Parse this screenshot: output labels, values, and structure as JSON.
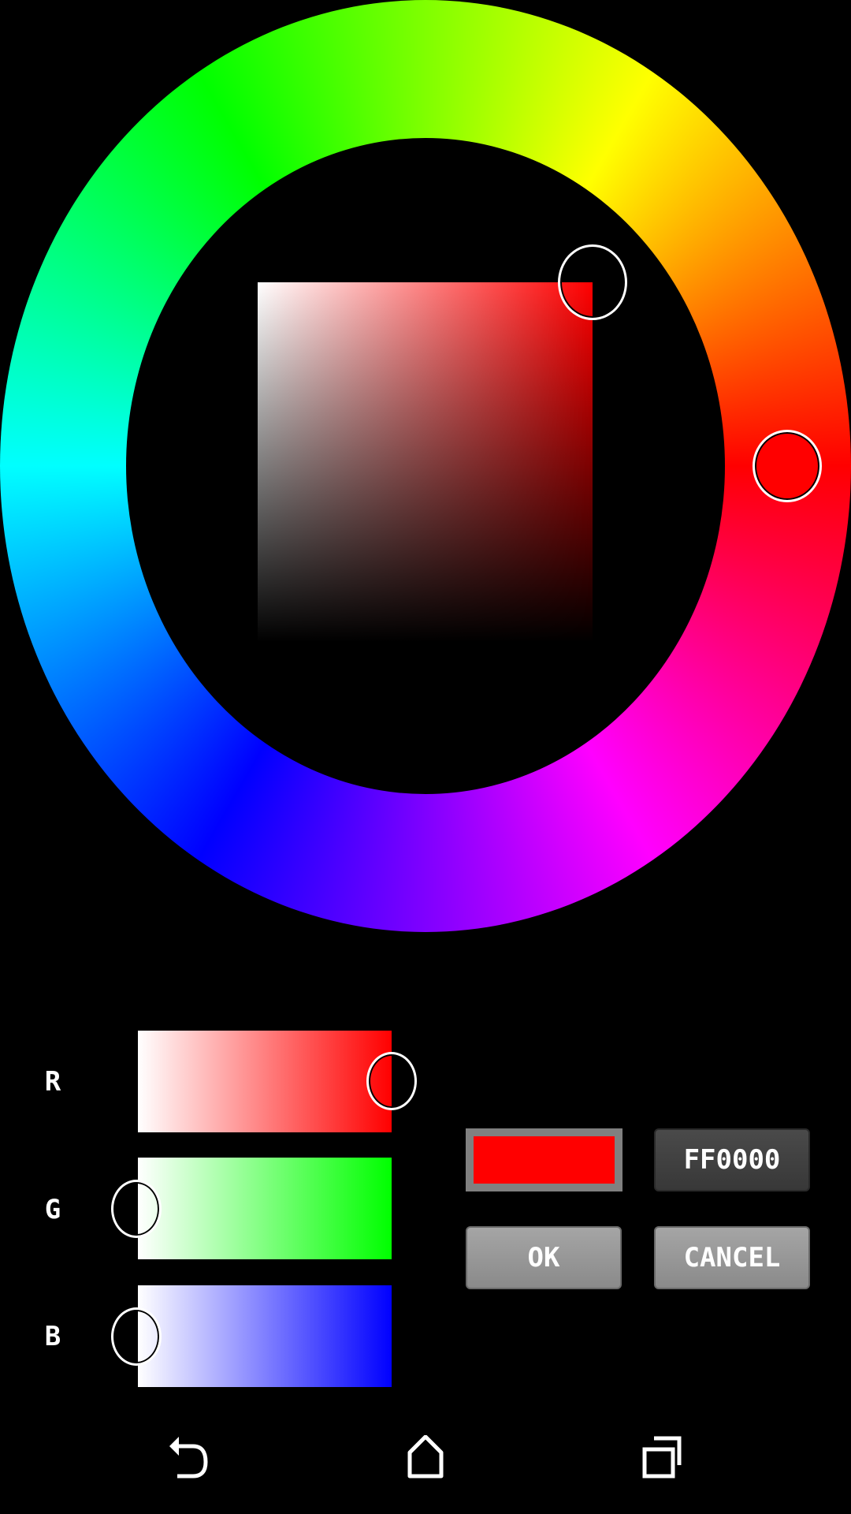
{
  "picker": {
    "selected_color": "#FF0000",
    "hue_degrees": 0,
    "saturation": 1.0,
    "value": 1.0
  },
  "sliders": [
    {
      "label": "R",
      "value": 255,
      "color": "#FF0000"
    },
    {
      "label": "G",
      "value": 0,
      "color": "#00FF00"
    },
    {
      "label": "B",
      "value": 0,
      "color": "#0000FF"
    }
  ],
  "hex_value": "FF0000",
  "buttons": {
    "ok": "OK",
    "cancel": "CANCEL"
  },
  "navbar": {
    "icons": [
      "back-icon",
      "home-icon",
      "recents-icon"
    ]
  }
}
